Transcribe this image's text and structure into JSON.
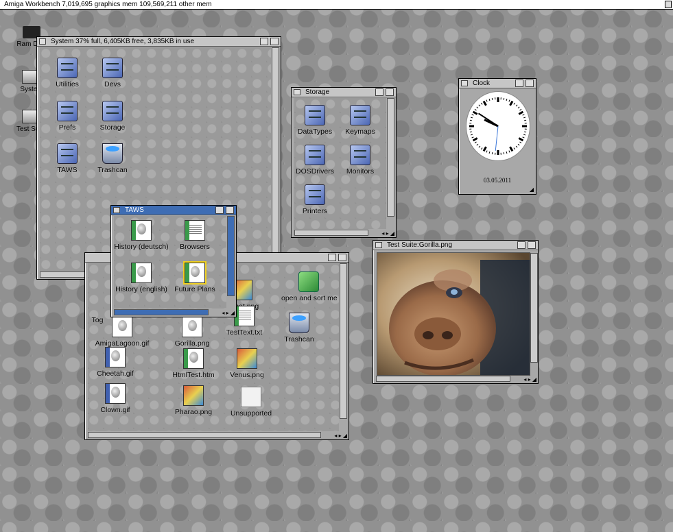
{
  "menubar": {
    "title": "Amiga Workbench  7,019,695 graphics mem  109,569,211 other mem"
  },
  "desktop_icons": [
    {
      "label": "Ram Disk",
      "type": "chip-icon"
    },
    {
      "label": "System",
      "type": "harddisk-icon"
    },
    {
      "label": "Test Suite",
      "type": "harddisk-icon"
    }
  ],
  "system_window": {
    "title": "System  37% full, 6,405KB free, 3,835KB in use",
    "icons": [
      {
        "label": "Utilities",
        "type": "drawer-icon"
      },
      {
        "label": "Devs",
        "type": "drawer-icon"
      },
      {
        "label": "Prefs",
        "type": "drawer-icon"
      },
      {
        "label": "Storage",
        "type": "drawer-icon"
      },
      {
        "label": "TAWS",
        "type": "drawer-icon"
      },
      {
        "label": "Trashcan",
        "type": "trashcan-icon"
      }
    ]
  },
  "storage_window": {
    "title": "Storage",
    "icons": [
      {
        "label": "DataTypes",
        "type": "drawer-icon"
      },
      {
        "label": "Keymaps",
        "type": "drawer-icon"
      },
      {
        "label": "DOSDrivers",
        "type": "drawer-icon"
      },
      {
        "label": "Monitors",
        "type": "drawer-icon"
      },
      {
        "label": "Printers",
        "type": "drawer-icon"
      }
    ]
  },
  "clock_window": {
    "title": "Clock",
    "date": "03.05.2011",
    "time": {
      "hour": 9,
      "minute": 50,
      "second": 31
    }
  },
  "testsuite_window": {
    "icons": [
      {
        "label": "Tog",
        "type": "document-icon"
      },
      {
        "label": "Robot.png",
        "type": "image-icon"
      },
      {
        "label": "open and sort me",
        "type": "drawer-icon"
      },
      {
        "label": "AmigaLagoon.gif",
        "type": "image-icon"
      },
      {
        "label": "Gorilla.png",
        "type": "image-icon"
      },
      {
        "label": "TestText.txt",
        "type": "document-icon"
      },
      {
        "label": "Trashcan",
        "type": "trashcan-icon"
      },
      {
        "label": "Cheetah.gif",
        "type": "image-icon"
      },
      {
        "label": "HtmlTest.htm",
        "type": "document-icon"
      },
      {
        "label": "Venus.png",
        "type": "image-icon"
      },
      {
        "label": "Clown.gif",
        "type": "image-icon"
      },
      {
        "label": "Pharao.png",
        "type": "image-icon"
      },
      {
        "label": "Unsupported",
        "type": "blank-document-icon"
      }
    ]
  },
  "taws_window": {
    "title": "TAWS",
    "icons": [
      {
        "label": "History (deutsch)",
        "type": "html-document-icon"
      },
      {
        "label": "Browsers",
        "type": "text-document-icon"
      },
      {
        "label": "History (english)",
        "type": "html-document-icon"
      },
      {
        "label": "Future Plans",
        "type": "html-document-icon"
      }
    ]
  },
  "gorilla_window": {
    "title": "Test Suite:Gorilla.png"
  }
}
